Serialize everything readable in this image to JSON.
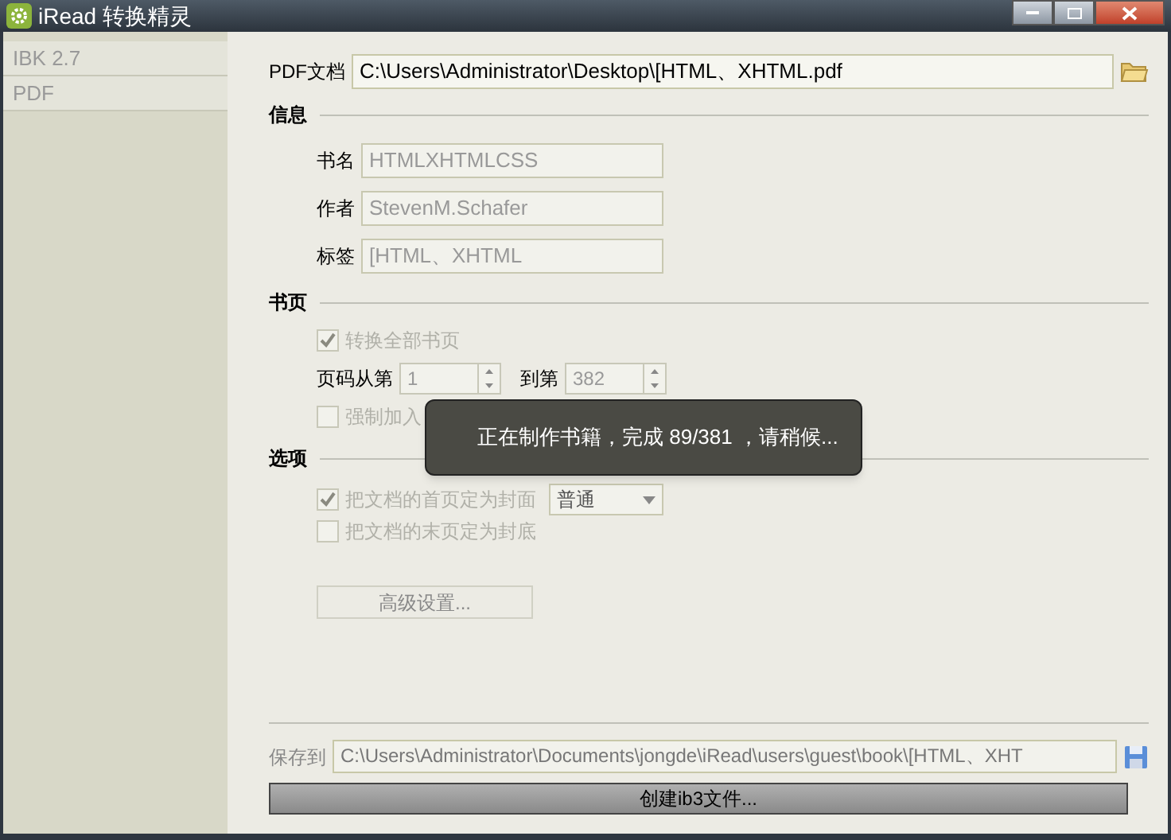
{
  "window": {
    "title": "iRead 转换精灵"
  },
  "sidebar": {
    "items": [
      {
        "label": "IBK 2.7",
        "selected": false
      },
      {
        "label": "PDF",
        "selected": false
      }
    ]
  },
  "pdf_file": {
    "label": "PDF文档",
    "value": "C:\\Users\\Administrator\\Desktop\\[HTML、XHTML.pdf"
  },
  "info": {
    "title": "信息",
    "fields": [
      {
        "label": "书名",
        "value": "HTMLXHTMLCSS",
        "disabled": true
      },
      {
        "label": "作者",
        "value": "StevenM.Schafer",
        "disabled": true
      },
      {
        "label": "标签",
        "value": "[HTML、XHTML",
        "disabled": true
      }
    ]
  },
  "pages": {
    "title": "书页",
    "convert_all": {
      "label": "转换全部书页",
      "checked": true,
      "disabled": true
    },
    "range": {
      "from_label": "页码从第",
      "from_value": "1",
      "to_label": "到第",
      "to_value": "382"
    },
    "force_page_numbers": {
      "label": "强制加入",
      "checked": false,
      "disabled": true
    }
  },
  "options": {
    "title": "选项",
    "checkboxes": [
      {
        "label": "把文档的首页定为封面",
        "checked": true,
        "disabled": true
      },
      {
        "label": "把文档的末页定为封底",
        "checked": false,
        "disabled": true
      }
    ],
    "cover_style": "普通",
    "advanced_button": "高级设置..."
  },
  "save": {
    "label": "保存到",
    "value": "C:\\Users\\Administrator\\Documents\\jongde\\iRead\\users\\guest\\book\\[HTML、XHT"
  },
  "create_button": "创建ib3文件...",
  "toast": "正在制作书籍，完成 89/381 ，请稍候..."
}
